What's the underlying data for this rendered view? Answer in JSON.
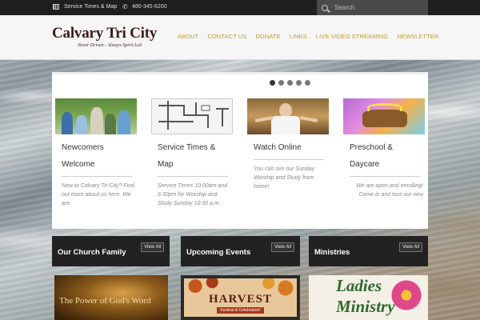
{
  "topbar": {
    "service_times": "Service Times & Map",
    "phone": "480-345-6200",
    "search_placeholder": "Search"
  },
  "header": {
    "logo_name": "Calvary Tri City",
    "logo_tagline": "Never Driven - Always Spirit Led",
    "nav": [
      "ABOUT",
      "CONTACT US",
      "DONATE",
      "LINKS",
      "LIVE VIDEO STREAMING",
      "NEWSLETTER"
    ]
  },
  "slider": {
    "slide_count": 5,
    "active_slide": 1
  },
  "features": [
    {
      "title": "Newcomers Welcome",
      "desc": "New to Calvary Tri-City? Find out more about us here. We are",
      "image": "people-photo"
    },
    {
      "title": "Service Times & Map",
      "desc": "Service Times 10:00am and 6:30pm for Worship and Study Sunday 10:00 a.m.",
      "image": "street-map"
    },
    {
      "title": "Watch Online",
      "desc": "You can see our Sunday Worship and Study from home!",
      "image": "preacher-photo"
    },
    {
      "title": "Preschool & Daycare",
      "desc": "We are open and enrolling! Come in and tour our new",
      "image": "preschool-photo"
    }
  ],
  "categories": [
    {
      "title": "Our Church Family",
      "button": "View All"
    },
    {
      "title": "Upcoming Events",
      "button": "View All"
    },
    {
      "title": "Ministries",
      "button": "View All"
    }
  ],
  "bottom_images": {
    "word": "The Power of God's Word",
    "harvest_title": "HARVEST",
    "harvest_sub": "Festival & Celebration!",
    "ladies": "Ladies Ministry"
  },
  "colors": {
    "nav": "#c49a3a",
    "topbar": "#1e1e1e",
    "logo": "#3b1a1a"
  }
}
